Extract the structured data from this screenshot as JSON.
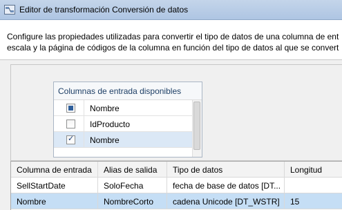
{
  "window": {
    "title": "Editor de transformación Conversión de datos"
  },
  "header": {
    "description_line1": "Configure las propiedades utilizadas para convertir el tipo de datos de una columna de ent",
    "description_line2": "escala y la página de códigos de la columna en función del tipo de datos al que se convert"
  },
  "input_columns": {
    "title": "Columnas de entrada disponibles",
    "rows": [
      {
        "label": "Nombre",
        "state": "partial"
      },
      {
        "label": "IdProducto",
        "state": "unchecked"
      },
      {
        "label": "Nombre",
        "state": "checked"
      }
    ]
  },
  "grid": {
    "columns": [
      "Columna de entrada",
      "Alias de salida",
      "Tipo de datos",
      "Longitud"
    ],
    "rows": [
      {
        "input": "SellStartDate",
        "alias": "SoloFecha",
        "type": "fecha de base de datos [DT...",
        "length": ""
      },
      {
        "input": "Nombre",
        "alias": "NombreCorto",
        "type": "cadena Unicode [DT_WSTR]",
        "length": "15"
      }
    ]
  }
}
